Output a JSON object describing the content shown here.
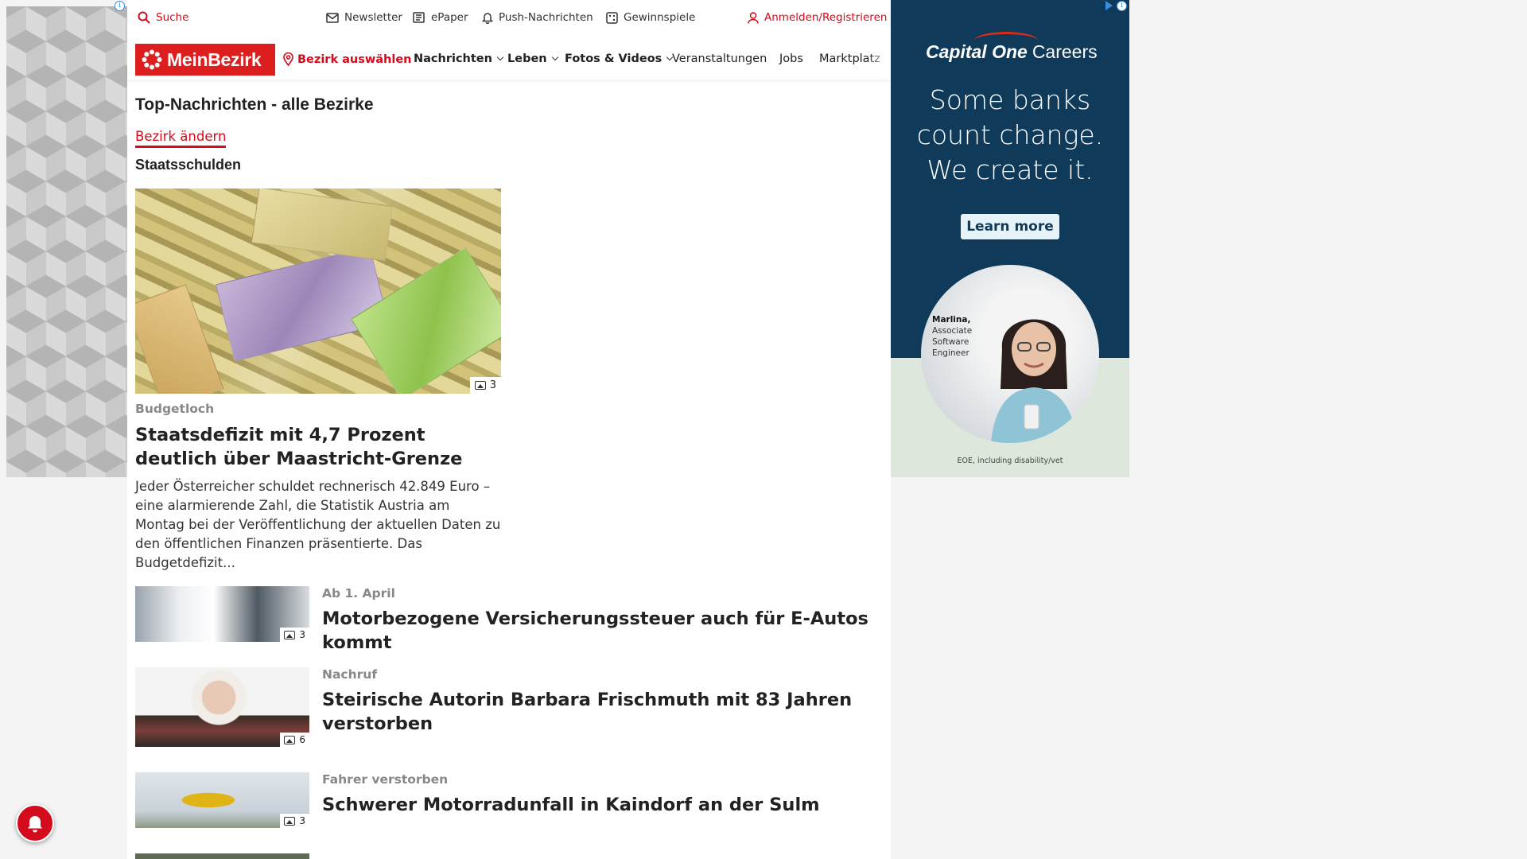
{
  "topbar": {
    "search": "Suche",
    "newsletter": "Newsletter",
    "epaper": "ePaper",
    "push": "Push-Nachrichten",
    "games": "Gewinnspiele",
    "login": "Anmelden/Registrieren"
  },
  "nav": {
    "logo": "MeinBezirk",
    "choose_district": "Bezirk auswählen",
    "items": [
      "Nachrichten",
      "Leben",
      "Fotos & Videos",
      "Veranstaltungen",
      "Jobs",
      "Marktplatz"
    ]
  },
  "page": {
    "title": "Top-Nachrichten - alle Bezirke",
    "change_link": "Bezirk ändern",
    "section": "Staatsschulden"
  },
  "hero": {
    "image_count": "3",
    "kicker": "Budgetloch",
    "headline": "Staatsdefizit mit 4,7 Prozent deutlich über Maastricht-Grenze",
    "teaser": "Jeder Österreicher schuldet rechnerisch 42.849 Euro – eine alarmierende Zahl, die Statistik Austria am Montag bei der Veröffentlichung der aktuellen Daten zu den öffentlichen Finanzen präsentierte. Das Budgetdefizit..."
  },
  "articles": [
    {
      "kicker": "Ab 1. April",
      "headline": "Motorbezogene Versicherungssteuer auch für E-Autos kommt",
      "image_count": "3"
    },
    {
      "kicker": "Nachruf",
      "headline": "Steirische Autorin Barbara Frischmuth mit 83 Jahren verstorben",
      "image_count": "6"
    },
    {
      "kicker": "Fahrer verstorben",
      "headline": "Schwerer Motorradunfall in Kaindorf an der Sulm",
      "image_count": "3"
    }
  ],
  "ad_right": {
    "brand": "Capital One",
    "brand_suffix": "Careers",
    "slogan_1": "Some banks",
    "slogan_2": "count change.",
    "slogan_3": "We create it.",
    "cta": "Learn more",
    "person_name": "Marlina,",
    "person_role_1": "Associate",
    "person_role_2": "Software",
    "person_role_3": "Engineer",
    "disclaimer": "EOE, including disability/vet"
  },
  "colors": {
    "brand_red": "#d40b1c",
    "ad_navy": "#0f3a5a"
  }
}
